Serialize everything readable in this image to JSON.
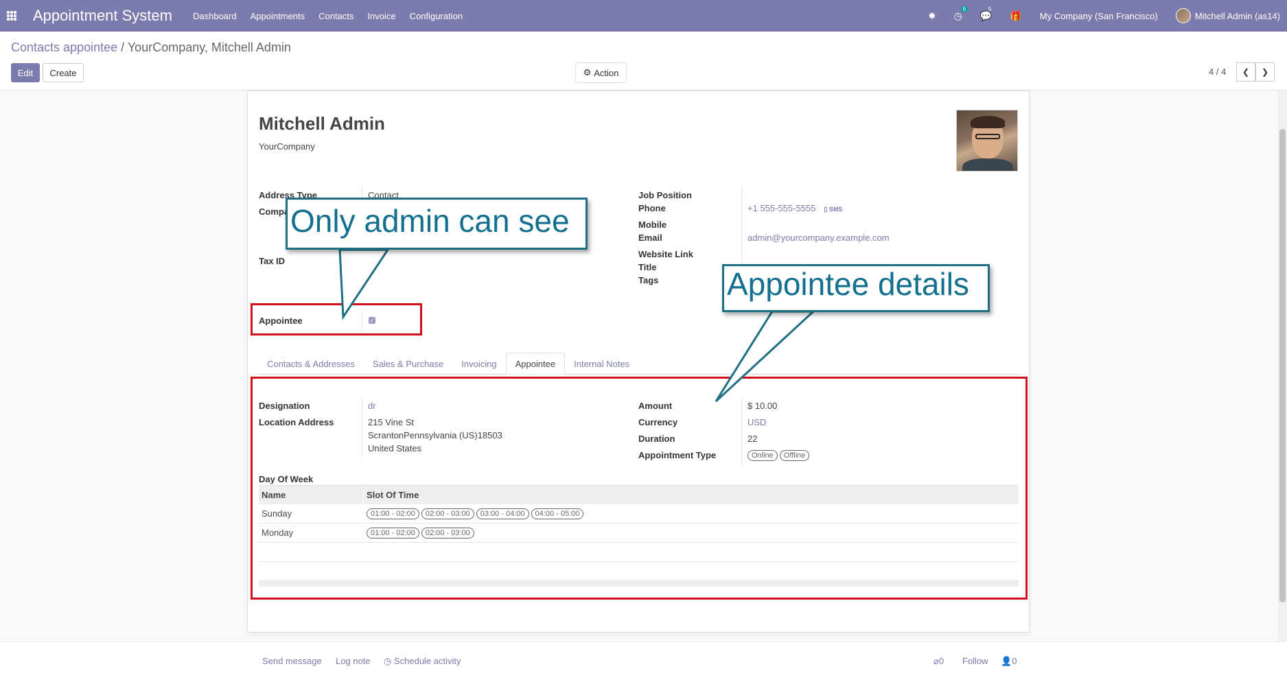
{
  "topbar": {
    "app_title": "Appointment System",
    "menu": [
      "Dashboard",
      "Appointments",
      "Contacts",
      "Invoice",
      "Configuration"
    ],
    "activity_count": "6",
    "message_count": "5",
    "company": "My Company (San Francisco)",
    "user": "Mitchell Admin (as14)",
    "bg_color": "#7c7bad"
  },
  "breadcrumb": {
    "parent": "Contacts appointee",
    "separator": "/",
    "current": "YourCompany, Mitchell Admin"
  },
  "buttons": {
    "edit": "Edit",
    "create": "Create",
    "action": "Action"
  },
  "pager": {
    "value": "4 / 4",
    "prev_icon": "chevron-left-icon",
    "next_icon": "chevron-right-icon"
  },
  "record": {
    "name": "Mitchell Admin",
    "company": "YourCompany",
    "labels": {
      "address_type": "Address Type",
      "company": "Compa",
      "tax_id": "Tax ID",
      "appointee": "Appointee",
      "job_position": "Job Position",
      "phone": "Phone",
      "mobile": "Mobile",
      "email": "Email",
      "website": "Website Link",
      "title": "Title",
      "tags": "Tags"
    },
    "address_type": "Contact",
    "phone": "+1 555-555-5555",
    "sms": "SMS",
    "email": "admin@yourcompany.example.com",
    "appointee_checked": true
  },
  "tabs": [
    {
      "label": "Contacts & Addresses",
      "active": false
    },
    {
      "label": "Sales & Purchase",
      "active": false
    },
    {
      "label": "Invoicing",
      "active": false
    },
    {
      "label": "Appointee",
      "active": true
    },
    {
      "label": "Internal Notes",
      "active": false
    }
  ],
  "appointee_tab": {
    "labels": {
      "designation": "Designation",
      "location": "Location Address",
      "amount": "Amount",
      "currency": "Currency",
      "duration": "Duration",
      "appointment_type": "Appointment Type",
      "day_of_week": "Day Of Week"
    },
    "designation": "dr",
    "address_line1": "215 Vine St",
    "address_line2": "ScrantonPennsylvania (US)18503",
    "address_line3": "United States",
    "amount": "$ 10.00",
    "currency": "USD",
    "duration": "22",
    "appointment_types": [
      "Online",
      "Offline"
    ],
    "table": {
      "headers": [
        "Name",
        "Slot Of Time"
      ],
      "rows": [
        {
          "name": "Sunday",
          "slots": [
            "01:00 - 02:00",
            "02:00 - 03:00",
            "03:00 - 04:00",
            "04:00 - 05:00"
          ]
        },
        {
          "name": "Monday",
          "slots": [
            "01:00 - 02:00",
            "02:00 - 03:00"
          ]
        }
      ]
    }
  },
  "annotations": {
    "callout_admin": "Only admin can see",
    "callout_details": "Appointee details",
    "box_color": "#d0111b",
    "callout_color": "#1e6e84"
  },
  "chatter": {
    "send_message": "Send message",
    "log_note": "Log note",
    "schedule_activity": "Schedule activity",
    "attachments": "0",
    "follow": "Follow",
    "followers": "0"
  }
}
